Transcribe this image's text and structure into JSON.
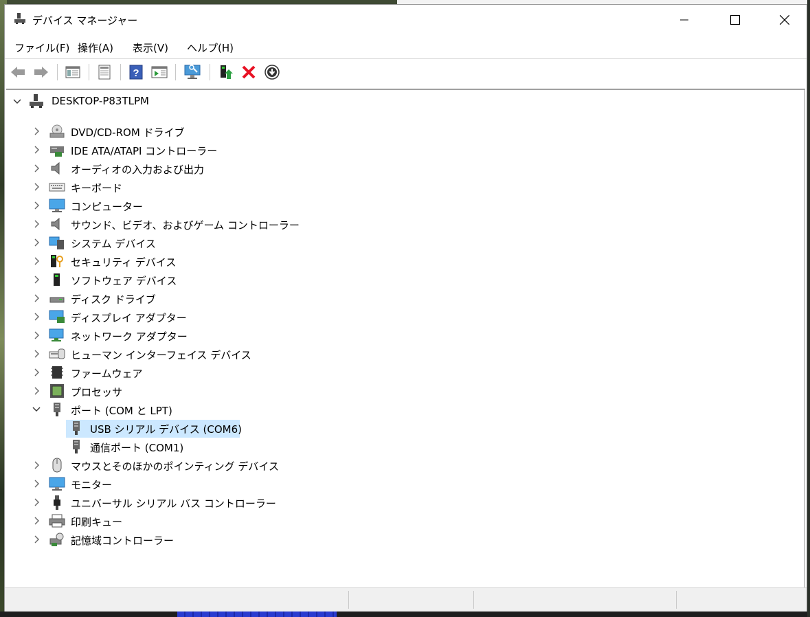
{
  "window": {
    "title": "デバイス マネージャー"
  },
  "menu": [
    "ファイル(F)",
    "操作(A)",
    "表示(V)",
    "ヘルプ(H)"
  ],
  "toolbar": {
    "buttons": [
      "back-icon",
      "forward-icon",
      "show-hide-console-tree-icon",
      "properties-icon",
      "help-icon",
      "action-pane-icon",
      "scan-hardware-icon",
      "update-driver-icon",
      "uninstall-icon",
      "disable-device-icon"
    ],
    "accent_red": "#e81123"
  },
  "tree": {
    "root": "DESKTOP-P83TLPM",
    "categories": [
      "DVD/CD-ROM ドライブ",
      "IDE ATA/ATAPI コントローラー",
      "オーディオの入力および出力",
      "キーボード",
      "コンピューター",
      "サウンド、ビデオ、およびゲーム コントローラー",
      "システム デバイス",
      "セキュリティ デバイス",
      "ソフトウェア デバイス",
      "ディスク ドライブ",
      "ディスプレイ アダプター",
      "ネットワーク アダプター",
      "ヒューマン インターフェイス デバイス",
      "ファームウェア",
      "プロセッサ",
      "ポート (COM と LPT)",
      "マウスとそのほかのポインティング デバイス",
      "モニター",
      "ユニバーサル シリアル バス コントローラー",
      "印刷キュー",
      "記憶域コントローラー"
    ],
    "ports_children": [
      "USB シリアル デバイス (COM6)",
      "通信ポート (COM1)"
    ],
    "selected": "USB シリアル デバイス (COM6)",
    "selection_color": "#cce8ff"
  }
}
